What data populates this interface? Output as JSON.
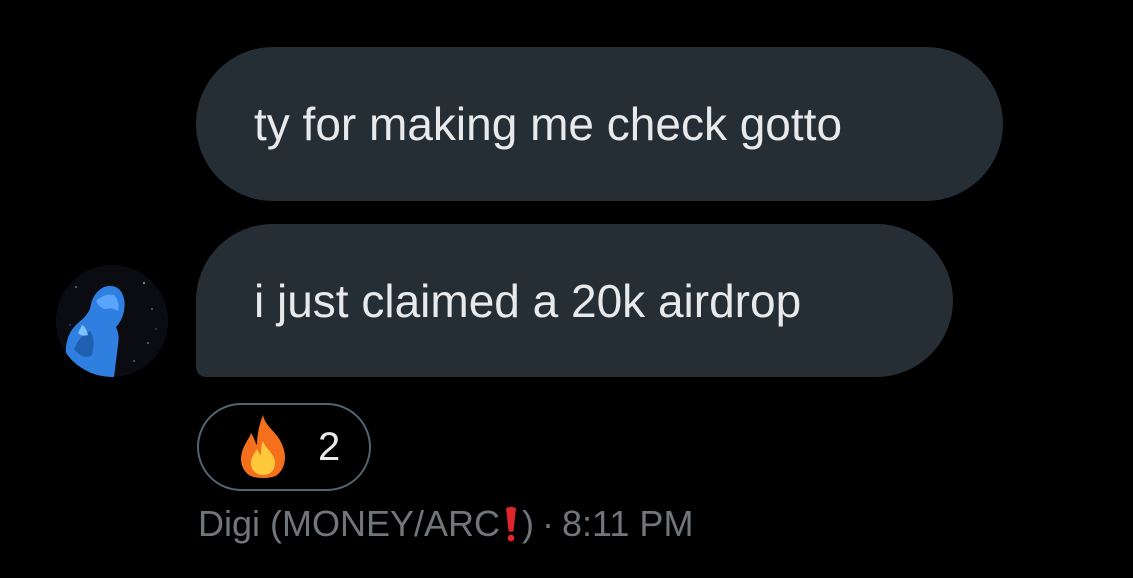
{
  "messages": [
    {
      "text": "ty for making me check gotto"
    },
    {
      "text": "i just claimed a 20k airdrop"
    }
  ],
  "reaction": {
    "emoji_icon": "fire-emoji-icon",
    "count": "2"
  },
  "meta": {
    "sender_prefix": "Digi (MONEY/ARC",
    "sender_icon": "red-exclamation-icon",
    "sender_suffix": ")",
    "separator": "·",
    "time": "8:11 PM"
  },
  "avatar": {
    "icon": "blue-figure-avatar"
  },
  "colors": {
    "background": "#000000",
    "bubble": "#252e35",
    "text": "#e7e9ea",
    "muted": "#71767b",
    "pill_border": "#536471",
    "accent_red": "#e0242c"
  }
}
